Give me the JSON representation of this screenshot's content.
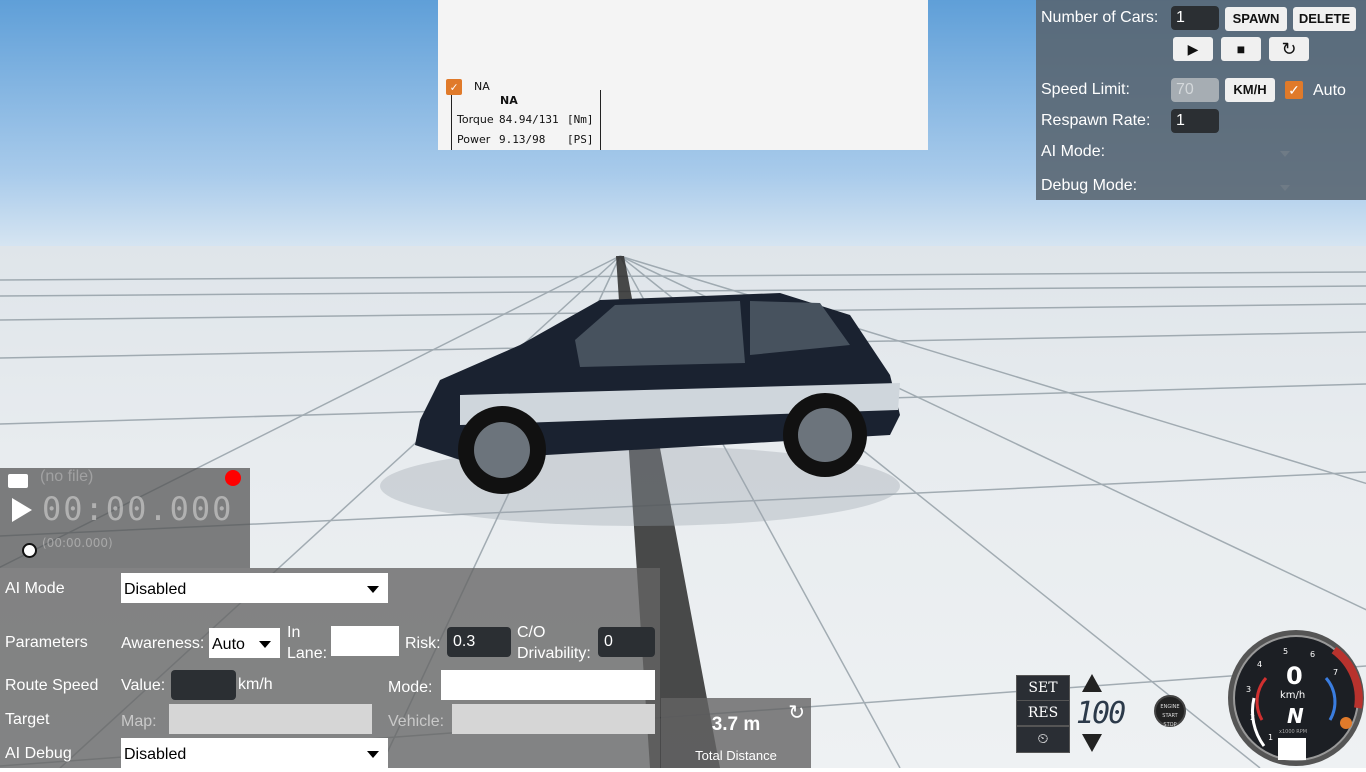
{
  "graph": {
    "checkbox_label": "NA",
    "header": "NA",
    "rows": [
      {
        "label": "Torque",
        "value": "84.94/131",
        "unit": "[Nm]"
      },
      {
        "label": "Power",
        "value": "9.13/98",
        "unit": "[PS]"
      }
    ]
  },
  "traffic": {
    "num_cars_label": "Number of Cars:",
    "num_cars_value": "1",
    "spawn_label": "SPAWN",
    "delete_label": "DELETE",
    "speed_limit_label": "Speed Limit:",
    "speed_limit_value": "70",
    "unit_label": "KM/H",
    "auto_label": "Auto",
    "respawn_label": "Respawn Rate:",
    "respawn_value": "1",
    "ai_mode_label": "AI Mode:",
    "debug_mode_label": "Debug Mode:"
  },
  "replay": {
    "file": "(no file)",
    "time": "00:00.000",
    "subtime": "(00:00.000)"
  },
  "ai": {
    "ai_mode_label": "AI Mode",
    "ai_mode_value": "Disabled",
    "parameters_label": "Parameters",
    "awareness_label": "Awareness:",
    "awareness_value": "Auto",
    "in_lane_label_1": "In",
    "in_lane_label_2": "Lane:",
    "risk_label": "Risk:",
    "risk_value": "0.3",
    "co_label_1": "C/O",
    "co_label_2": "Drivability:",
    "co_value": "0",
    "route_speed_label": "Route Speed",
    "value_label": "Value:",
    "kmh_label": "km/h",
    "mode_label": "Mode:",
    "target_label": "Target",
    "map_label": "Map:",
    "vehicle_label": "Vehicle:",
    "ai_debug_label": "AI Debug",
    "ai_debug_value": "Disabled"
  },
  "distance": {
    "value": "3.7 m",
    "label": "Total Distance"
  },
  "cruise": {
    "set_label": "SET",
    "res_label": "RES",
    "speed": "100"
  },
  "dash": {
    "speed": "0",
    "unit": "km/h",
    "gear": "N",
    "rpm_label": "x1000 RPM",
    "start_label_1": "ENGINE",
    "start_label_2": "START",
    "start_label_3": "STOP",
    "ticks": [
      "1",
      "2",
      "3",
      "4",
      "5",
      "6",
      "7"
    ]
  },
  "colors": {
    "accent": "#e07a2a",
    "panel": "#58646f"
  }
}
